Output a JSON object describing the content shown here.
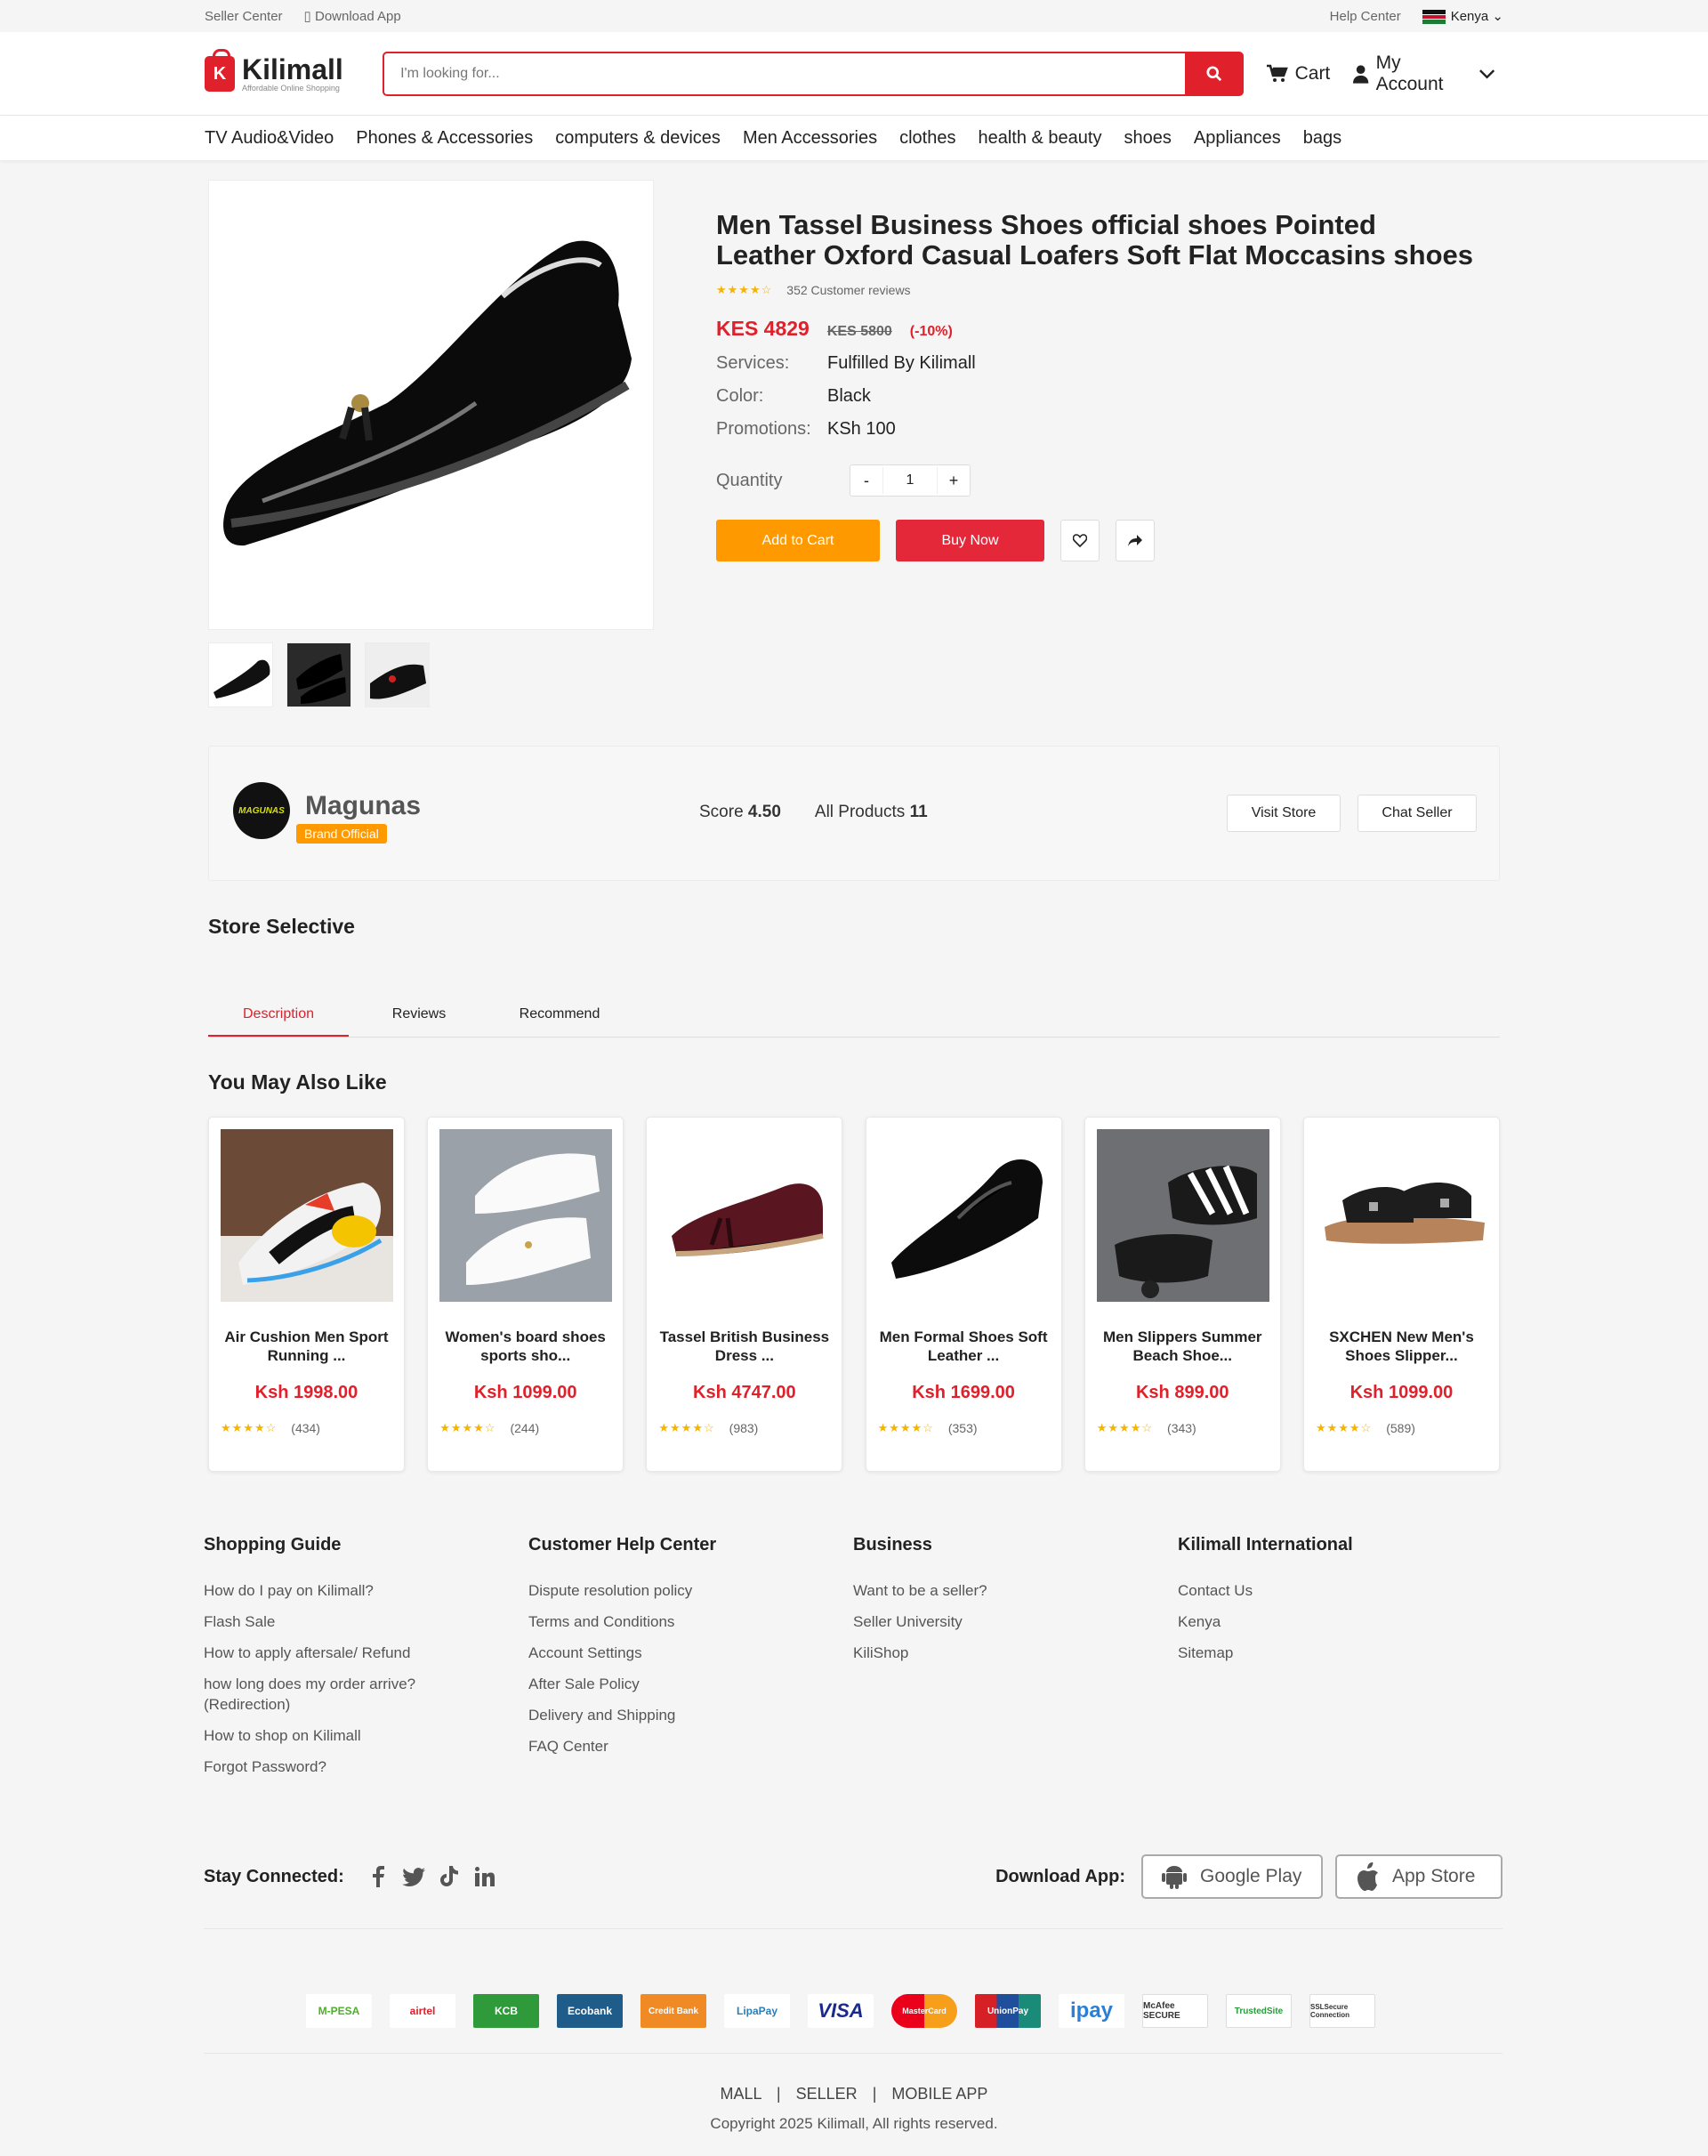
{
  "topbar": {
    "seller_center": "Seller Center",
    "download_app": "Download App",
    "help_center": "Help Center",
    "country": "Kenya"
  },
  "header": {
    "logo_name": "Kilimall",
    "logo_tagline": "Affordable Online Shopping",
    "search_placeholder": "I'm looking for...",
    "cart_label": "Cart",
    "account_label": "My Account"
  },
  "categories": [
    "TV Audio&Video",
    "Phones & Accessories",
    "computers & devices",
    "Men Accessories",
    "clothes",
    "health & beauty",
    "shoes",
    "Appliances",
    "bags"
  ],
  "product": {
    "title": "Men Tassel Business Shoes official shoes Pointed Leather Oxford Casual Loafers Soft Flat Moccasins shoes",
    "stars": "★★★★☆",
    "reviews": "352 Customer reviews",
    "price": "KES 4829",
    "old_price": "KES 5800",
    "discount": "(-10%)",
    "attributes": [
      {
        "label": "Services:",
        "value": "Fulfilled By Kilimall"
      },
      {
        "label": "Color:",
        "value": "Black"
      },
      {
        "label": "Promotions:",
        "value": "KSh 100"
      }
    ],
    "quantity_label": "Quantity",
    "quantity_minus": "-",
    "quantity_value": "1",
    "quantity_plus": "+",
    "add_to_cart": "Add to Cart",
    "buy_now": "Buy Now"
  },
  "store": {
    "logo_text": "MAGUNAS",
    "name": "Magunas",
    "badge": "Brand Official",
    "score_label": "Score",
    "score_value": "4.50",
    "products_label": "All Products",
    "products_value": "11",
    "visit_store": "Visit Store",
    "chat_seller": "Chat Seller"
  },
  "store_selective_title": "Store Selective",
  "tabs": [
    "Description",
    "Reviews",
    "Recommend"
  ],
  "also_like": {
    "title": "You May Also Like",
    "items": [
      {
        "title": "Air Cushion Men Sport Running ...",
        "price": "Ksh 1998.00",
        "stars": "★★★★☆",
        "count": "(434)"
      },
      {
        "title": "Women's board shoes sports sho...",
        "price": "Ksh 1099.00",
        "stars": "★★★★☆",
        "count": "(244)"
      },
      {
        "title": "Tassel British Business Dress ...",
        "price": "Ksh 4747.00",
        "stars": "★★★★☆",
        "count": "(983)"
      },
      {
        "title": "Men Formal Shoes Soft Leather ...",
        "price": "Ksh 1699.00",
        "stars": "★★★★☆",
        "count": "(353)"
      },
      {
        "title": "Men Slippers Summer Beach Shoe...",
        "price": "Ksh 899.00",
        "stars": "★★★★☆",
        "count": "(343)"
      },
      {
        "title": "SXCHEN New Men's Shoes Slipper...",
        "price": "Ksh 1099.00",
        "stars": "★★★★☆",
        "count": "(589)"
      }
    ]
  },
  "footer": {
    "columns": [
      {
        "title": "Shopping Guide",
        "links": [
          "How do I pay on Kilimall?",
          "Flash Sale",
          "How to apply aftersale/ Refund",
          "how long does my order arrive?(Redirection)",
          "How to shop on Kilimall",
          "Forgot Password?"
        ]
      },
      {
        "title": "Customer Help Center",
        "links": [
          "Dispute resolution policy",
          "Terms and Conditions",
          "Account Settings",
          "After Sale Policy",
          "Delivery and Shipping",
          "FAQ Center"
        ]
      },
      {
        "title": "Business",
        "links": [
          "Want to be a seller?",
          "Seller University",
          "KiliShop"
        ]
      },
      {
        "title": "Kilimall International",
        "links": [
          "Contact Us",
          "Kenya",
          "Sitemap"
        ]
      }
    ],
    "stay_connected": "Stay Connected:",
    "download_app": "Download App:",
    "google_play": "Google Play",
    "app_store": "App Store",
    "payments": [
      "M-PESA",
      "airtel",
      "KCB",
      "Ecobank",
      "Credit Bank",
      "LipaPay",
      "VISA",
      "MasterCard",
      "UnionPay",
      "ipay",
      "McAfee SECURE",
      "TrustedSite",
      "SSLSecure Connection"
    ],
    "bottom_links": [
      "MALL",
      "SELLER",
      "MOBILE APP"
    ],
    "separator": "|",
    "copyright": "Copyright 2025 Kilimall, All rights reserved."
  },
  "colors": {
    "brand_red": "#e0202a",
    "orange": "#ff9900",
    "star": "#f5b400"
  }
}
